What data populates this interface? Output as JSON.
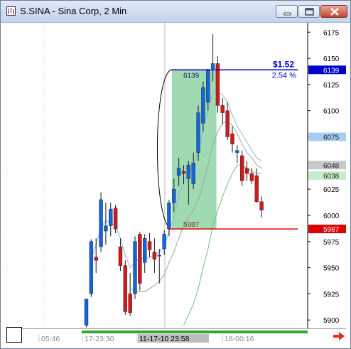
{
  "window": {
    "title": "S.SINA - Sina Corp, 2 Min"
  },
  "icons": {
    "app": "chart-app-icon",
    "minimize": "minimize-icon",
    "maximize": "maximize-icon",
    "close": "close-icon",
    "scroll_right": "right-arrow-icon"
  },
  "colors": {
    "bull": "#1565d8",
    "bear": "#d0191d",
    "blue_line": "#0000cc",
    "red_line": "#dd0000",
    "highlight": "#8fd4a6",
    "axis_bar": "#2fa82f"
  },
  "chart_data": {
    "type": "candlestick",
    "title": "",
    "ylim": [
      5892,
      6184
    ],
    "y_ticks": [
      5900,
      5925,
      5950,
      5975,
      6000,
      6025,
      6050,
      6075,
      6100,
      6125,
      6150,
      6175
    ],
    "x_labels": [
      "05:46",
      "17-23:30",
      "11-17-10  23:58",
      "18-00:16"
    ],
    "price_tags": [
      {
        "label": "6139",
        "value": 6139,
        "style": "blue"
      },
      {
        "label": "6075",
        "value": 6075,
        "style": "lightblue"
      },
      {
        "label": "6048",
        "value": 6048,
        "style": "gray"
      },
      {
        "label": "6038",
        "value": 6038,
        "style": "lightgreen"
      },
      {
        "label": "5987",
        "value": 5987,
        "style": "red"
      }
    ],
    "annotation": {
      "high_label": "6139",
      "low_label": "5987",
      "change": "$1.52",
      "change_pct": "2.54 %"
    },
    "candles": [
      {
        "o": 5895,
        "h": 5920,
        "l": 5893,
        "c": 5920
      },
      {
        "o": 5925,
        "h": 5977,
        "l": 5922,
        "c": 5975
      },
      {
        "o": 5960,
        "h": 5978,
        "l": 5945,
        "c": 5957
      },
      {
        "o": 5970,
        "h": 6022,
        "l": 5965,
        "c": 6015
      },
      {
        "o": 5985,
        "h": 6012,
        "l": 5972,
        "c": 5990
      },
      {
        "o": 5990,
        "h": 6012,
        "l": 5980,
        "c": 6006
      },
      {
        "o": 6007,
        "h": 6010,
        "l": 5983,
        "c": 5987
      },
      {
        "o": 5970,
        "h": 5978,
        "l": 5947,
        "c": 5952
      },
      {
        "o": 5952,
        "h": 5957,
        "l": 5905,
        "c": 5908
      },
      {
        "o": 5925,
        "h": 5945,
        "l": 5904,
        "c": 5907
      },
      {
        "o": 5925,
        "h": 5980,
        "l": 5920,
        "c": 5975
      },
      {
        "o": 5982,
        "h": 5984,
        "l": 5928,
        "c": 5935
      },
      {
        "o": 5955,
        "h": 5982,
        "l": 5945,
        "c": 5978
      },
      {
        "o": 5975,
        "h": 5983,
        "l": 5960,
        "c": 5967
      },
      {
        "o": 5965,
        "h": 5978,
        "l": 5945,
        "c": 5958
      },
      {
        "o": 5962,
        "h": 5968,
        "l": 5935,
        "c": 5962
      },
      {
        "o": 5968,
        "h": 5986,
        "l": 5962,
        "c": 5982
      },
      {
        "o": 5987,
        "h": 6015,
        "l": 5980,
        "c": 6012
      },
      {
        "o": 6012,
        "h": 6035,
        "l": 6003,
        "c": 6025
      },
      {
        "o": 6038,
        "h": 6055,
        "l": 6028,
        "c": 6045
      },
      {
        "o": 6042,
        "h": 6048,
        "l": 6030,
        "c": 6040
      },
      {
        "o": 6035,
        "h": 6052,
        "l": 6010,
        "c": 6048
      },
      {
        "o": 6030,
        "h": 6060,
        "l": 6025,
        "c": 6050
      },
      {
        "o": 6060,
        "h": 6105,
        "l": 6052,
        "c": 6098
      },
      {
        "o": 6088,
        "h": 6128,
        "l": 6080,
        "c": 6122
      },
      {
        "o": 6108,
        "h": 6140,
        "l": 6100,
        "c": 6139
      },
      {
        "o": 6140,
        "h": 6173,
        "l": 6128,
        "c": 6145
      },
      {
        "o": 6145,
        "h": 6152,
        "l": 6098,
        "c": 6105
      },
      {
        "o": 6105,
        "h": 6112,
        "l": 6087,
        "c": 6098
      },
      {
        "o": 6100,
        "h": 6108,
        "l": 6072,
        "c": 6075
      },
      {
        "o": 6078,
        "h": 6085,
        "l": 6060,
        "c": 6068
      },
      {
        "o": 6060,
        "h": 6067,
        "l": 6050,
        "c": 6062
      },
      {
        "o": 6057,
        "h": 6062,
        "l": 6028,
        "c": 6033
      },
      {
        "o": 6045,
        "h": 6052,
        "l": 6033,
        "c": 6040
      },
      {
        "o": 6040,
        "h": 6045,
        "l": 6030,
        "c": 6033
      },
      {
        "o": 6038,
        "h": 6045,
        "l": 6012,
        "c": 6013
      },
      {
        "o": 6013,
        "h": 6018,
        "l": 5998,
        "c": 6005
      }
    ],
    "series": [
      {
        "values": [
          null,
          5958,
          5972,
          5988,
          5995,
          5993,
          5990,
          5978,
          5962,
          5950,
          5955,
          5960,
          5958,
          5960,
          5962,
          5965,
          5970,
          5985,
          5998,
          6018,
          6032,
          6040,
          6048,
          6060,
          6082,
          6100,
          6118,
          6118,
          6115,
          6108,
          6096,
          6085,
          6078,
          6070,
          6062,
          6055,
          6052
        ]
      },
      {
        "values": [
          null,
          null,
          null,
          null,
          null,
          null,
          null,
          null,
          null,
          5930,
          5928,
          5927,
          5927,
          5930,
          5933,
          5937,
          5943,
          5955,
          5965,
          5978,
          5990,
          5998,
          6005,
          6015,
          6030,
          6048,
          6068,
          6080,
          6088,
          6090,
          6086,
          6078,
          6068,
          6060,
          6055,
          6048,
          6045
        ]
      },
      {
        "values": [
          null,
          null,
          null,
          null,
          null,
          null,
          null,
          null,
          null,
          null,
          null,
          null,
          null,
          null,
          null,
          null,
          null,
          null,
          null,
          null,
          5895,
          5905,
          5915,
          5930,
          5950,
          5968,
          5990,
          6005,
          6018,
          6030,
          6040,
          6048,
          6048,
          6045,
          6042,
          6040,
          6040
        ]
      }
    ]
  }
}
